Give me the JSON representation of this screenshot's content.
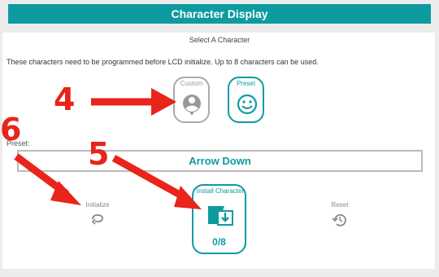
{
  "window": {
    "title": "Character Display"
  },
  "header": {
    "select_title": "Select A Character"
  },
  "notice": "These characters need to be programmed before LCD initialize. Up to 8 characters can be used.",
  "options": {
    "custom_label": "Custom",
    "preset_label": "Preset"
  },
  "preset": {
    "label": "Preset:",
    "value": "Arrow Down"
  },
  "actions": {
    "initialize_label": "Initialize",
    "install_label": "Install Character",
    "install_count": "0/8",
    "reset_label": "Reset"
  },
  "annotations": {
    "n4": "4",
    "n5": "5",
    "n6": "6"
  },
  "colors": {
    "accent": "#0d9ba0",
    "annotation": "#e8241b",
    "disabled": "#aaaaaa"
  },
  "icons": {
    "custom": "person-circle-icon",
    "preset": "smiley-icon",
    "initialize": "loop-icon",
    "install": "install-download-icon",
    "reset": "history-icon"
  }
}
